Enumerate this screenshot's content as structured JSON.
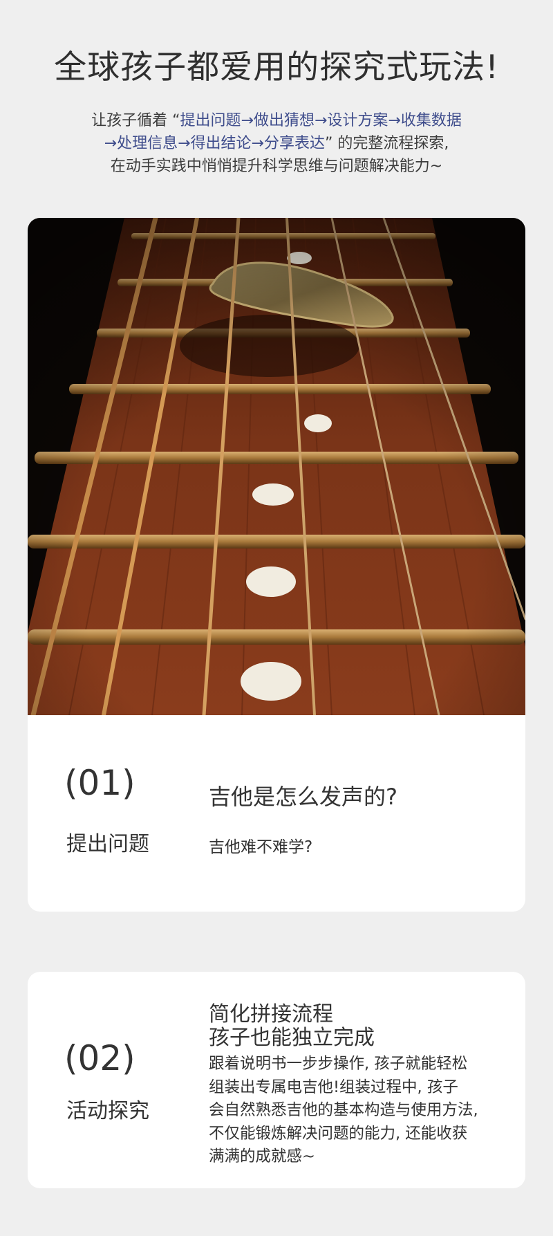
{
  "header": {
    "title": "全球孩子都爱用的探究式玩法!",
    "intro_prefix": "让孩子循着 “",
    "intro_flow_line1": "提出问题→做出猜想→设计方案→收集数据",
    "intro_flow_line2": "→处理信息→得出结论→分享表达",
    "intro_suffix": "” 的完整流程探索,",
    "intro_line3": "在动手实践中悄悄提升科学思维与问题解决能力~"
  },
  "steps": [
    {
      "number": "(01)",
      "label": "提出问题",
      "question_main": "吉他是怎么发声的?",
      "question_sub": "吉他难不难学?"
    },
    {
      "number": "(02)",
      "label": "活动探究",
      "heading_line1": "简化拼接流程",
      "heading_line2": "孩子也能独立完成",
      "body_line1": "跟着说明书一步步操作, 孩子就能轻松",
      "body_line2": "组装出专属电吉他!组装过程中, 孩子",
      "body_line3": "会自然熟悉吉他的基本构造与使用方法,",
      "body_line4": "不仅能锻炼解决问题的能力, 还能收获",
      "body_line5": "满满的成就感~"
    }
  ],
  "colors": {
    "background": "#efefef",
    "card": "#ffffff",
    "flow_text": "#3f4d8c",
    "text": "#333333"
  }
}
